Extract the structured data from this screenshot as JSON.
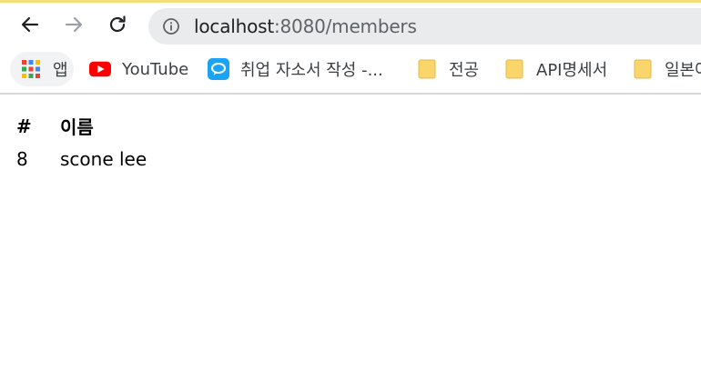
{
  "browser": {
    "url_host": "localhost",
    "url_rest": ":8080/members",
    "nav": {
      "back_icon": "arrow-left-icon",
      "forward_icon": "arrow-right-icon",
      "reload_icon": "reload-icon",
      "info_icon": "info-icon"
    },
    "bookmarks": [
      {
        "label": "앱",
        "icon": "apps-grid-icon"
      },
      {
        "label": "YouTube",
        "icon": "youtube-icon"
      },
      {
        "label": "취업 자소서 작성 -...",
        "icon": "chat-bubble-icon"
      },
      {
        "label": "전공",
        "icon": "folder-icon"
      },
      {
        "label": "API명세서",
        "icon": "folder-icon"
      },
      {
        "label": "일본어",
        "icon": "folder-icon"
      }
    ],
    "colors": {
      "accent": "#f3df7a",
      "omnibox": "#e9ebed",
      "folder": "#f9d56a",
      "youtube": "#ff0000",
      "chat": "#1aa3f5"
    }
  },
  "members_table": {
    "headers": {
      "id": "#",
      "name": "이름"
    },
    "rows": [
      {
        "id": "8",
        "name": "scone lee"
      }
    ]
  }
}
